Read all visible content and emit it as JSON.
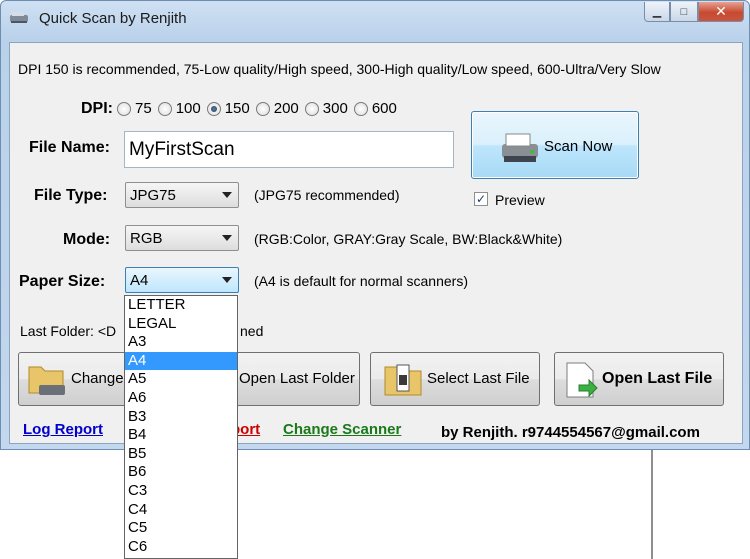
{
  "window": {
    "title": "Quick Scan by Renjith",
    "minimize": "▁",
    "maximize": "□",
    "close": "✕"
  },
  "info_text": "DPI 150 is recommended, 75-Low quality/High speed, 300-High quality/Low speed, 600-Ultra/Very Slow",
  "dpi": {
    "label": "DPI:",
    "options": [
      "75",
      "100",
      "150",
      "200",
      "300",
      "600"
    ],
    "selected": "150"
  },
  "file_name": {
    "label": "File Name:",
    "value": "MyFirstScan"
  },
  "file_type": {
    "label": "File Type:",
    "value": "JPG75",
    "hint": "(JPG75 recommended)"
  },
  "mode": {
    "label": "Mode:",
    "value": "RGB",
    "hint": "(RGB:Color, GRAY:Gray Scale, BW:Black&White)"
  },
  "paper_size": {
    "label": "Paper Size:",
    "value": "A4",
    "hint": "(A4 is default for normal scanners)",
    "options": [
      "LETTER",
      "LEGAL",
      "A3",
      "A4",
      "A5",
      "A6",
      "B3",
      "B4",
      "B5",
      "B6",
      "C3",
      "C4",
      "C5",
      "C6"
    ],
    "selected": "A4"
  },
  "scan_button": {
    "label": "Scan Now"
  },
  "preview": {
    "label": "Preview",
    "checked": true
  },
  "last_folder": {
    "label_visible_start": "Last Folder: <D",
    "label_visible_end": "ned"
  },
  "buttons": {
    "change_folder": "Change",
    "open_last_folder": "Open Last Folder",
    "select_last_file": "Select Last File",
    "open_last_file": "Open Last File"
  },
  "links": {
    "log_report": "Log Report",
    "hidden_report_tail": "port",
    "change_scanner": "Change Scanner",
    "credit": "by Renjith. r9744554567@gmail.com"
  },
  "colors": {
    "link_blue": "#0000cc",
    "link_red": "#cc0000",
    "link_green": "#1a7a1a",
    "selection": "#3399ff"
  }
}
